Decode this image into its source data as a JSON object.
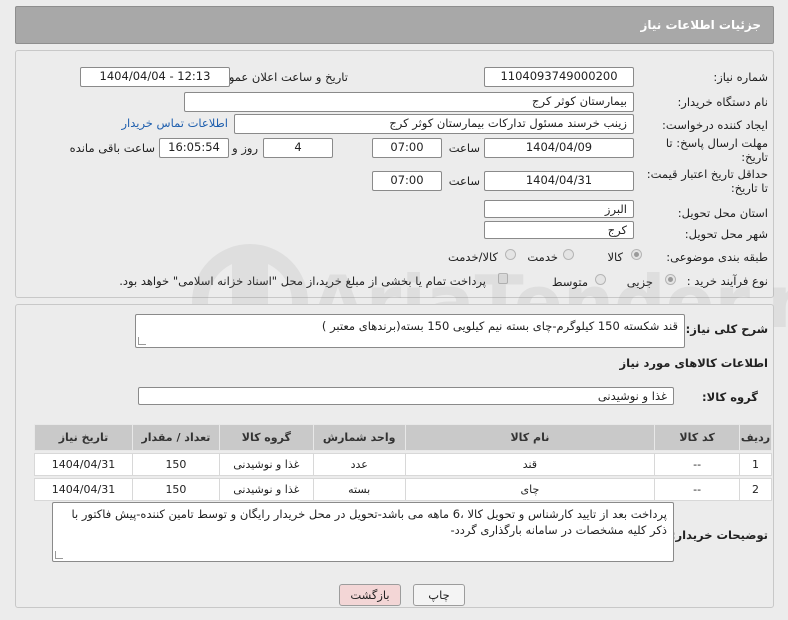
{
  "header": {
    "title": "جزئیات اطلاعات نیاز"
  },
  "form": {
    "need_number_label": "شماره نیاز:",
    "need_number": "1104093749000200",
    "announce_label": "تاریخ و ساعت اعلان عمومی:",
    "announce_value": "1404/04/04 - 12:13",
    "buyer_org_label": "نام دستگاه خریدار:",
    "buyer_org": "بیمارستان کوثر کرج",
    "creator_label": "ایجاد کننده درخواست:",
    "creator": "زینب خرسند مسئول تدارکات بیمارستان کوثر کرج",
    "contact_link": "اطلاعات تماس خریدار",
    "deadline_label_1": "مهلت ارسال پاسخ: تا",
    "deadline_label_2": "تاریخ:",
    "deadline_date": "1404/04/09",
    "time_label": "ساعت",
    "deadline_time": "07:00",
    "days_value": "4",
    "days_label": "روز و",
    "remaining_time": "16:05:54",
    "remaining_label": "ساعت باقی مانده",
    "price_valid_label_1": "حداقل تاریخ اعتبار قیمت:",
    "price_valid_label_2": "تا تاریخ:",
    "price_valid_date": "1404/04/31",
    "price_valid_time": "07:00",
    "province_label": "استان محل تحویل:",
    "province": "البرز",
    "city_label": "شهر محل تحویل:",
    "city": "کرج",
    "category_label": "طبقه بندی موضوعی:",
    "category_options": [
      "کالا",
      "خدمت",
      "کالا/خدمت"
    ],
    "category_selected": "کالا",
    "purchase_type_label": "نوع فرآیند خرید :",
    "purchase_options": [
      "جزیی",
      "متوسط"
    ],
    "purchase_selected": "جزیی",
    "payment_note": "پرداخت تمام یا بخشی از مبلغ خرید،از محل \"اسناد خزانه اسلامی\" خواهد بود."
  },
  "details": {
    "description_label": "شرح کلی نیاز:",
    "description": "قند شکسته 150 کیلوگرم-چای بسته نیم کیلویی 150 بسته(برندهای معتبر )",
    "goods_info_title": "اطلاعات کالاهای مورد نیاز",
    "goods_group_label": "گروه کالا:",
    "goods_group": "غذا و نوشیدنی",
    "table": {
      "headers": [
        "ردیف",
        "کد کالا",
        "نام کالا",
        "واحد شمارش",
        "گروه کالا",
        "تعداد / مقدار",
        "تاریخ نیاز"
      ],
      "rows": [
        [
          "1",
          "--",
          "قند",
          "عدد",
          "غذا و نوشیدنی",
          "150",
          "1404/04/31"
        ],
        [
          "2",
          "--",
          "چای",
          "بسته",
          "غذا و نوشیدنی",
          "150",
          "1404/04/31"
        ]
      ]
    },
    "buyer_notes_label": "توضیحات خریدار:",
    "buyer_notes": "پرداخت بعد از تایید کارشناس و تحویل کالا ،6 ماهه می باشد-تحویل در محل خریدار رایگان و توسط تامین کننده-پیش فاکتور با ذکر کلیه مشخصات در سامانه بارگذاری گردد-"
  },
  "buttons": {
    "print": "چاپ",
    "back": "بازگشت"
  },
  "watermark_text": "AriaTender.net",
  "colors": {
    "header_bg": "#a8a8a8",
    "link": "#1f5fae",
    "back_button_bg": "#f3d6d6"
  }
}
